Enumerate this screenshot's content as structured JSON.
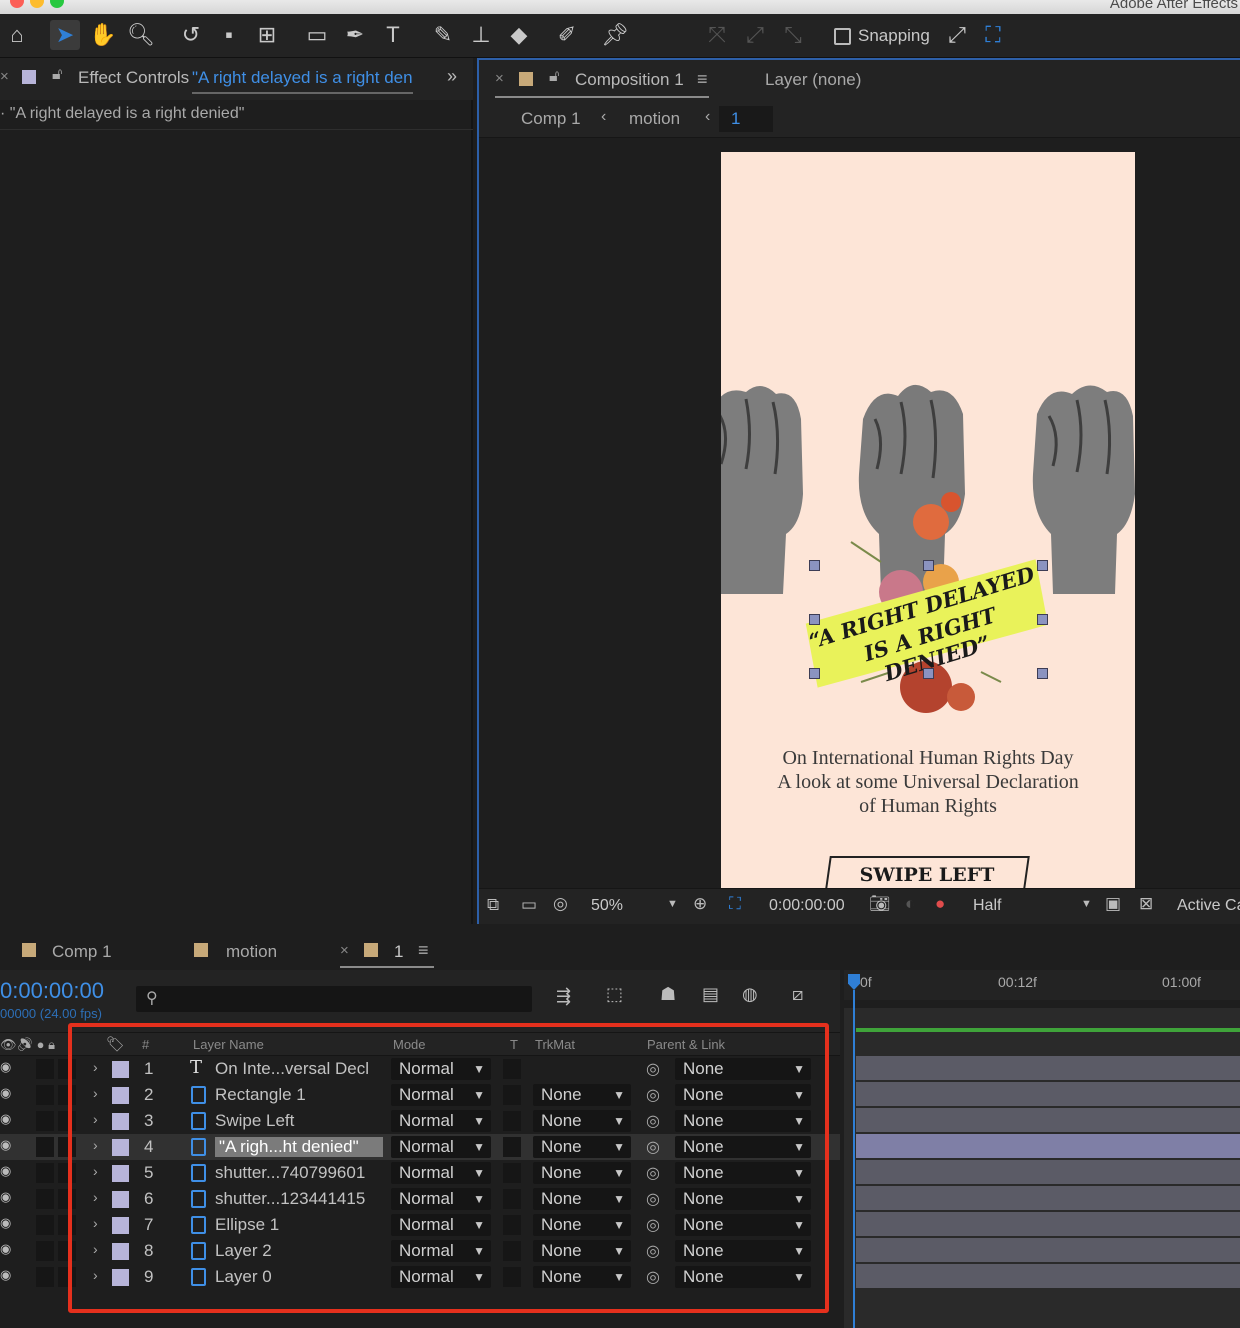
{
  "app": {
    "title": "Adobe After Effects"
  },
  "toolbar": {
    "snapping_label": "Snapping"
  },
  "effect_controls": {
    "tab_label": "Effect Controls",
    "layer_link": "\"A right delayed is a right den",
    "subheader": "\"A right delayed is a right denied\""
  },
  "composition": {
    "tab_label": "Composition 1",
    "layer_label": "Layer (none)",
    "breadcrumbs": [
      "Comp 1",
      "motion",
      "1"
    ],
    "zoom": "50%",
    "timecode": "0:00:00:00",
    "resolution": "Half",
    "camera": "Active Ca"
  },
  "artwork": {
    "banner_line1": "“A RIGHT DELAYED",
    "banner_line2": "IS A RIGHT DENIED”",
    "subtitle_line1": "On International Human Rights Day",
    "subtitle_line2": "A look at some Universal Declaration",
    "subtitle_line3": "of Human Rights",
    "swipe_label": "SWIPE LEFT",
    "background_color": "#fde5d7",
    "highlight_color": "#e9f25a"
  },
  "timeline": {
    "tabs": [
      "Comp 1",
      "motion",
      "1"
    ],
    "timecode": "0:00:00:00",
    "frame_info": "00000 (24.00 fps)",
    "ruler": [
      "0f",
      "00:12f",
      "01:00f"
    ],
    "columns": {
      "num": "#",
      "name": "Layer Name",
      "mode": "Mode",
      "t": "T",
      "trkmat": "TrkMat",
      "parent": "Parent & Link"
    },
    "layers": [
      {
        "num": "1",
        "name": "On Inte...versal Decl",
        "mode": "Normal",
        "trkmat": "",
        "parent": "None",
        "icon": "T"
      },
      {
        "num": "2",
        "name": "Rectangle 1",
        "mode": "Normal",
        "trkmat": "None",
        "parent": "None",
        "icon": "layer"
      },
      {
        "num": "3",
        "name": "Swipe Left",
        "mode": "Normal",
        "trkmat": "None",
        "parent": "None",
        "icon": "layer"
      },
      {
        "num": "4",
        "name": "\"A righ...ht denied\"",
        "mode": "Normal",
        "trkmat": "None",
        "parent": "None",
        "icon": "layer"
      },
      {
        "num": "5",
        "name": "shutter...740799601",
        "mode": "Normal",
        "trkmat": "None",
        "parent": "None",
        "icon": "layer"
      },
      {
        "num": "6",
        "name": "shutter...123441415",
        "mode": "Normal",
        "trkmat": "None",
        "parent": "None",
        "icon": "layer"
      },
      {
        "num": "7",
        "name": "Ellipse 1",
        "mode": "Normal",
        "trkmat": "None",
        "parent": "None",
        "icon": "layer"
      },
      {
        "num": "8",
        "name": "Layer 2",
        "mode": "Normal",
        "trkmat": "None",
        "parent": "None",
        "icon": "layer"
      },
      {
        "num": "9",
        "name": "Layer 0",
        "mode": "Normal",
        "trkmat": "None",
        "parent": "None",
        "icon": "layer"
      }
    ]
  },
  "colors": {
    "accent": "#2f7fd6",
    "highlight_box": "#e5301d",
    "label_swatch": "#b7b4d9"
  }
}
